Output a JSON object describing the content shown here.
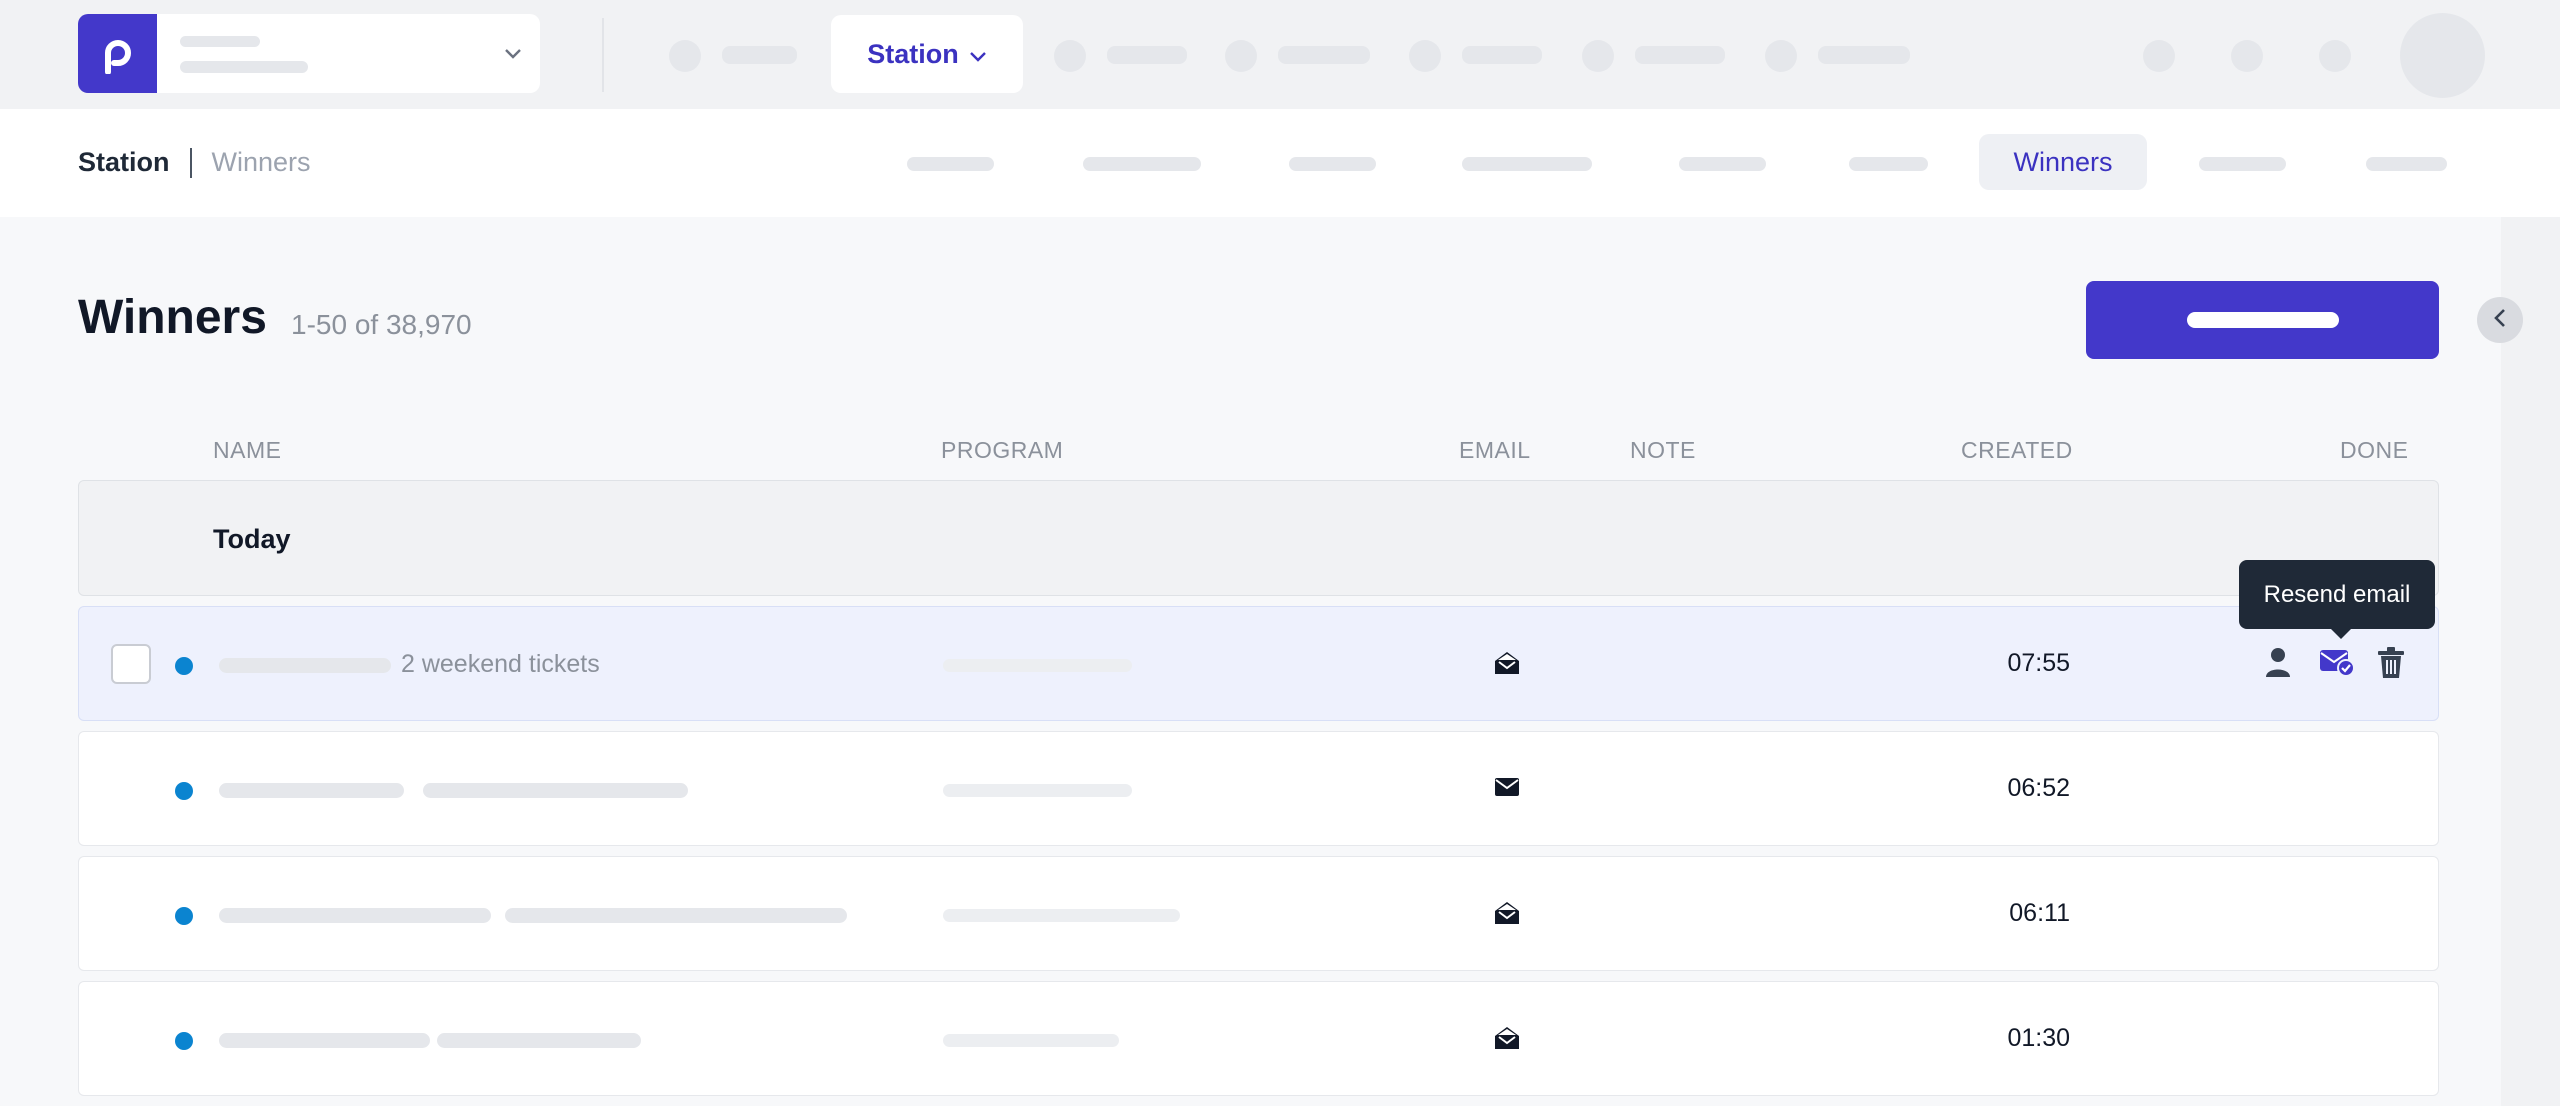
{
  "colors": {
    "brand": "#4338ca",
    "brand_text": "#3b32c0",
    "status_dot": "#0b84d0",
    "tooltip_bg": "#1f2937"
  },
  "topnav": {
    "logo_icon": "p-logo-icon",
    "station_label": "Station",
    "station_icon": "chevron-down-icon"
  },
  "breadcrumb": {
    "parent": "Station",
    "current": "Winners"
  },
  "subnav": {
    "active_tab": "Winners"
  },
  "page": {
    "title": "Winners",
    "count": "1-50 of 38,970"
  },
  "table": {
    "columns": {
      "name": "NAME",
      "program": "PROGRAM",
      "email": "EMAIL",
      "note": "NOTE",
      "created": "CREATED",
      "done": "DONE"
    },
    "group_label": "Today",
    "rows": [
      {
        "name_text": "2 weekend tickets",
        "email_status": "envelope-open-icon",
        "created": "07:55",
        "selected": true
      },
      {
        "name_text": "",
        "email_status": "envelope-icon",
        "created": "06:52",
        "selected": false
      },
      {
        "name_text": "",
        "email_status": "envelope-open-icon",
        "created": "06:11",
        "selected": false
      },
      {
        "name_text": "",
        "email_status": "envelope-open-icon",
        "created": "01:30",
        "selected": false
      }
    ],
    "row_actions": [
      "user-icon",
      "envelope-check-icon",
      "trash-icon"
    ]
  },
  "tooltip": {
    "text": "Resend email"
  }
}
